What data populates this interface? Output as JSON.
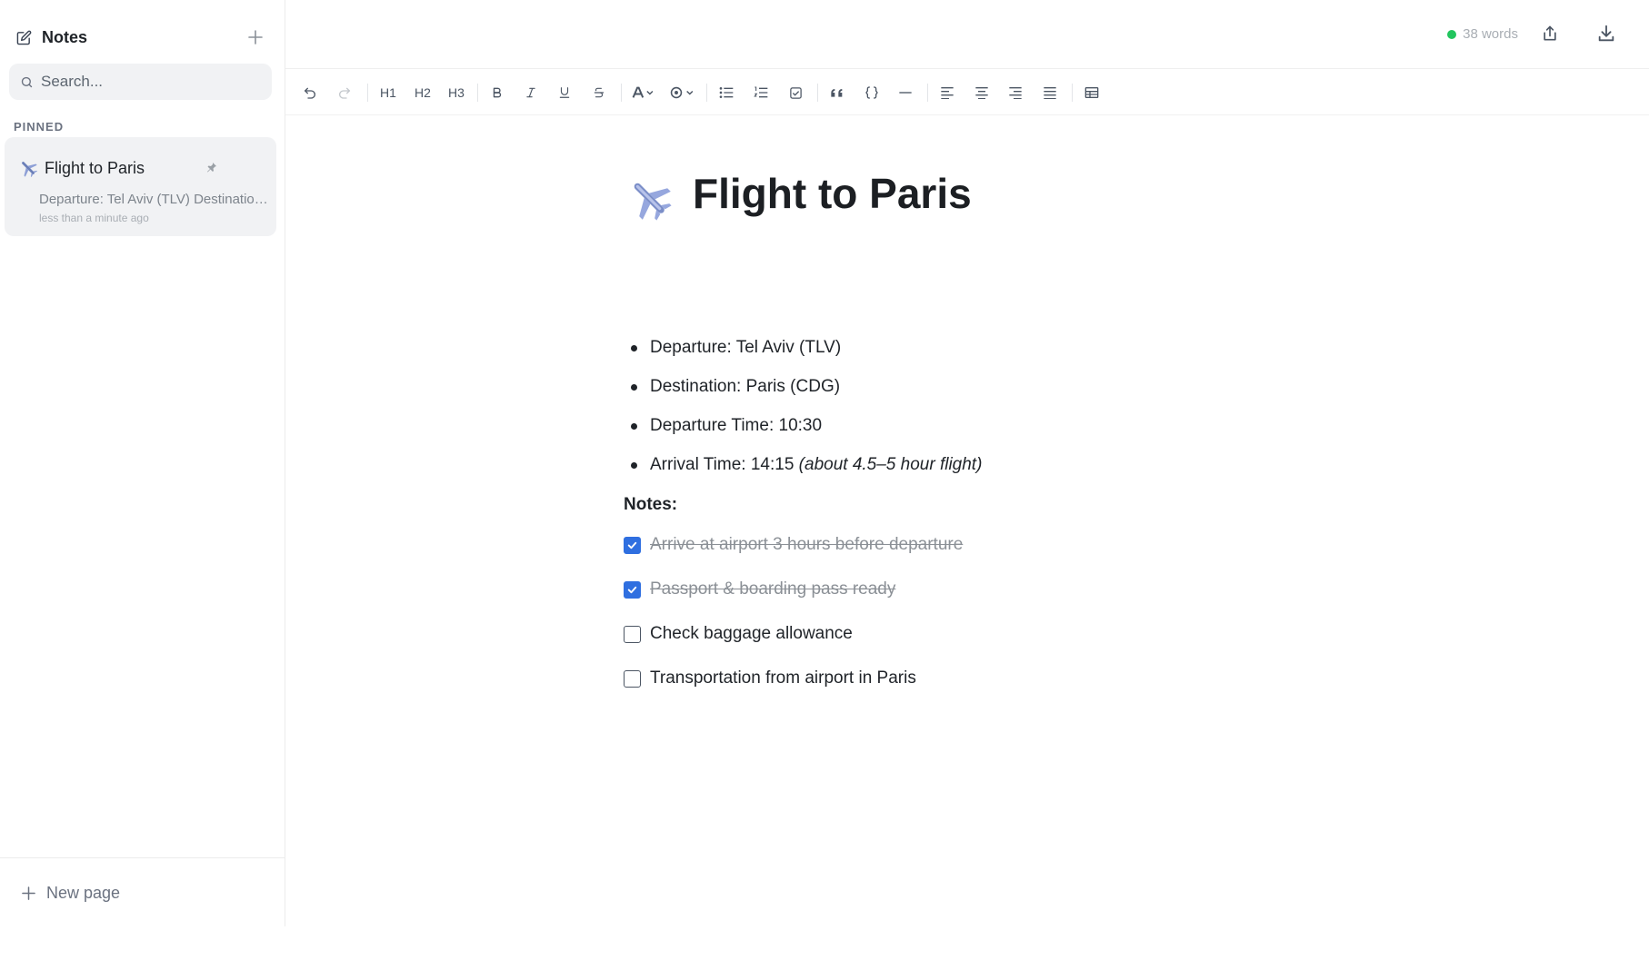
{
  "sidebar": {
    "title": "Notes",
    "search_placeholder": "Search...",
    "section_label": "PINNED",
    "note": {
      "emoji": "airplane",
      "title": "Flight to Paris",
      "preview": "Departure: Tel Aviv (TLV) Destination: Paris (CDG)",
      "time": "less than a minute ago"
    },
    "new_page_label": "New page"
  },
  "topbar": {
    "word_count": "38 words",
    "status_color": "#22c55e"
  },
  "toolbar": {
    "buttons": [
      "undo",
      "redo",
      "heading-1",
      "heading-2",
      "heading-3",
      "bold",
      "italic",
      "underline",
      "strikethrough",
      "text-color",
      "highlight",
      "bullet-list",
      "numbered-list",
      "task-list",
      "blockquote",
      "code-block",
      "horizontal-rule",
      "align-left",
      "align-center",
      "align-right",
      "align-justify",
      "table"
    ],
    "h1": "H1",
    "h2": "H2",
    "h3": "H3"
  },
  "document": {
    "title": "Flight to Paris",
    "emoji": "airplane",
    "bullets": [
      {
        "text": "Departure: Tel Aviv (TLV)",
        "italic": ""
      },
      {
        "text": "Destination: Paris (CDG)",
        "italic": ""
      },
      {
        "text": "Departure Time: 10:30",
        "italic": ""
      },
      {
        "text": "Arrival Time: 14:15 ",
        "italic": "(about 4.5–5 hour flight)"
      }
    ],
    "notes_heading": "Notes:",
    "tasks": [
      {
        "text": "Arrive at airport 3 hours before departure",
        "done": true
      },
      {
        "text": "Passport & boarding pass ready",
        "done": true
      },
      {
        "text": "Check baggage allowance",
        "done": false
      },
      {
        "text": "Transportation from airport in Paris",
        "done": false
      }
    ],
    "checkbox_color": "#2f6fe0"
  }
}
